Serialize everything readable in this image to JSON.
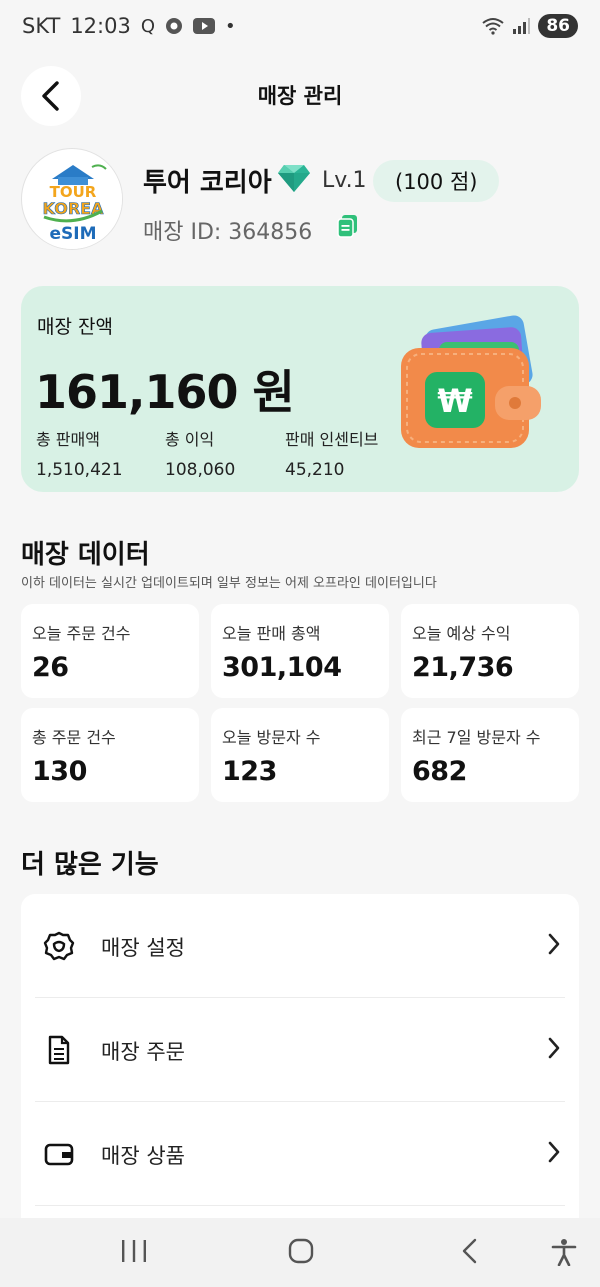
{
  "status_bar": {
    "carrier": "SKT",
    "time": "12:03",
    "battery": "86",
    "icons": [
      "q-icon",
      "chrome-icon",
      "youtube-icon",
      "dot-icon",
      "wifi-icon",
      "signal-icon"
    ],
    "q_label": "Q",
    "dot": "•"
  },
  "header": {
    "title": "매장 관리"
  },
  "store": {
    "name": "투어 코리아",
    "level": "Lv.1",
    "points": "(100 점)",
    "id_text": "매장 ID:  364856",
    "logo_text_1": "TOUR",
    "logo_text_2": "KOREA",
    "logo_text_3": "eSIM"
  },
  "balance": {
    "label": "매장 잔액",
    "value": "161,160 원",
    "stats": [
      {
        "label": "총 판매액",
        "value": "1,510,421"
      },
      {
        "label": "총 이익",
        "value": "108,060"
      },
      {
        "label": "판매 인센티브",
        "value": "45,210"
      }
    ]
  },
  "data_section": {
    "title": "매장 데이터",
    "subtitle": "이하 데이터는 실시간 업데이트되며 일부 정보는 어제 오프라인 데이터입니다",
    "metrics": [
      {
        "label": "오늘 주문 건수",
        "value": "26"
      },
      {
        "label": "오늘 판매 총액",
        "value": "301,104"
      },
      {
        "label": "오늘 예상 수익",
        "value": "21,736"
      },
      {
        "label": "총 주문 건수",
        "value": "130"
      },
      {
        "label": "오늘 방문자 수",
        "value": "123"
      },
      {
        "label": "최근 7일 방문자 수",
        "value": "682"
      }
    ]
  },
  "more_section": {
    "title": "더 많은 기능",
    "items": [
      {
        "label": "매장 설정",
        "icon": "gear-icon"
      },
      {
        "label": "매장 주문",
        "icon": "document-icon"
      },
      {
        "label": "매장 상품",
        "icon": "wallet-icon"
      }
    ]
  },
  "colors": {
    "accent_green": "#d8f1e5",
    "points_bg": "#e3f3ec",
    "copy_green": "#2fc07a"
  }
}
